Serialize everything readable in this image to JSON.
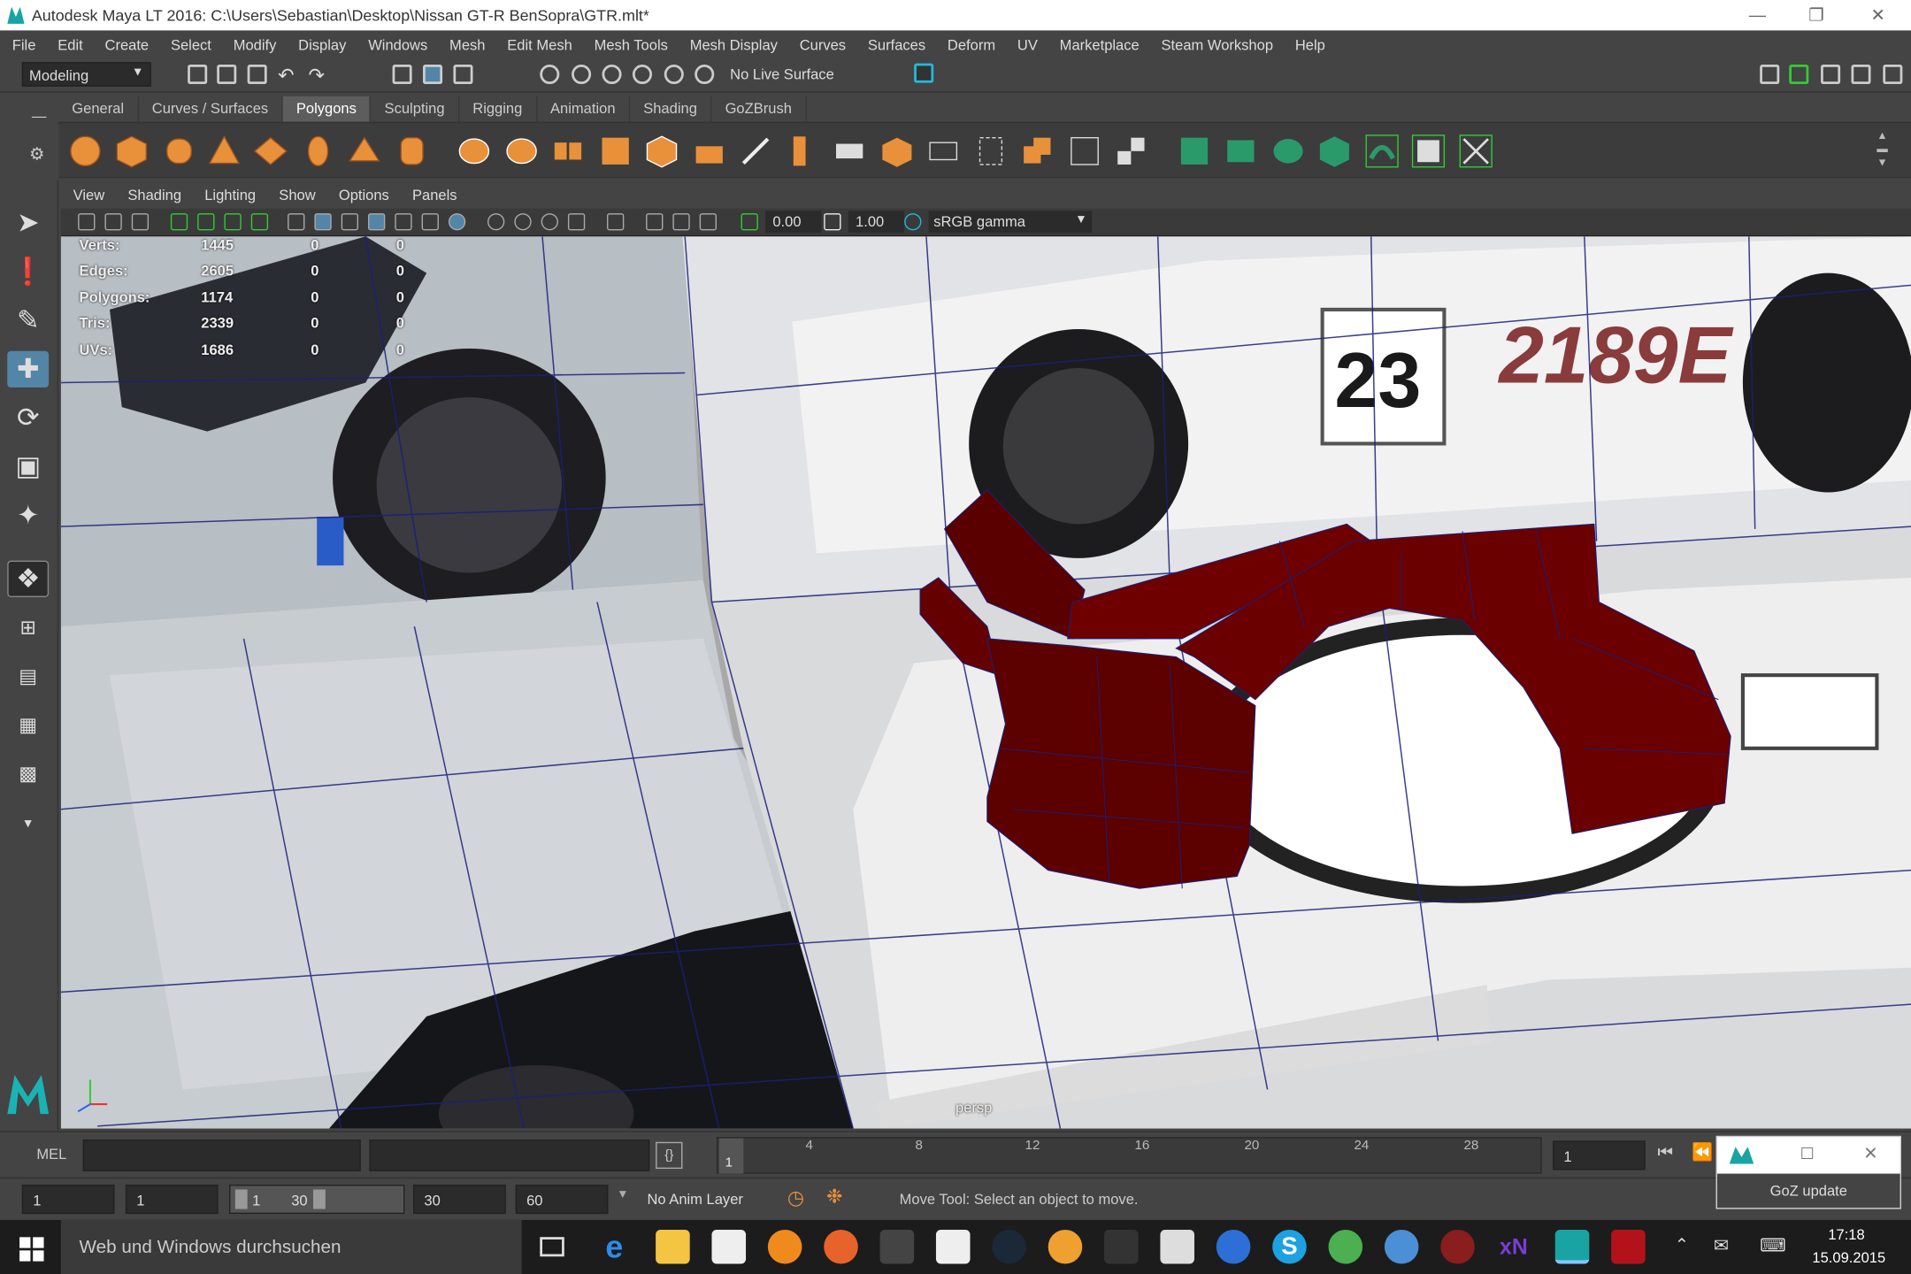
{
  "window": {
    "title": "Autodesk Maya LT 2016: C:\\Users\\Sebastian\\Desktop\\Nissan GT-R BenSopra\\GTR.mlt*"
  },
  "menu": [
    "File",
    "Edit",
    "Create",
    "Select",
    "Modify",
    "Display",
    "Windows",
    "Mesh",
    "Edit Mesh",
    "Mesh Tools",
    "Mesh Display",
    "Curves",
    "Surfaces",
    "Deform",
    "UV",
    "Marketplace",
    "Steam Workshop",
    "Help"
  ],
  "statusline": {
    "mode": "Modeling",
    "live_surface": "No Live Surface"
  },
  "shelf": {
    "tabs": [
      "General",
      "Curves / Surfaces",
      "Polygons",
      "Sculpting",
      "Rigging",
      "Animation",
      "Shading",
      "GoZBrush"
    ],
    "active": "Polygons"
  },
  "panel": {
    "menu": [
      "View",
      "Shading",
      "Lighting",
      "Show",
      "Options",
      "Panels"
    ],
    "exposure": "0.00",
    "gamma": "1.00",
    "colorspace": "sRGB gamma"
  },
  "hud": {
    "rows": [
      {
        "label": "Verts:",
        "a": "1445",
        "b": "0",
        "c": "0"
      },
      {
        "label": "Edges:",
        "a": "2605",
        "b": "0",
        "c": "0"
      },
      {
        "label": "Polygons:",
        "a": "1174",
        "b": "0",
        "c": "0"
      },
      {
        "label": "Tris:",
        "a": "2339",
        "b": "0",
        "c": "0"
      },
      {
        "label": "UVs:",
        "a": "1686",
        "b": "0",
        "c": "0"
      }
    ],
    "camera": "persp"
  },
  "timeline": {
    "ticks": [
      "1",
      "4",
      "8",
      "12",
      "16",
      "20",
      "24",
      "28"
    ],
    "current_frame": "1"
  },
  "command": {
    "label": "MEL"
  },
  "range": {
    "start": "1",
    "start2": "1",
    "slider_a": "1",
    "slider_b": "30",
    "end": "30",
    "end2": "60",
    "anim_layer": "No Anim Layer",
    "help": "Move Tool: Select an object to move."
  },
  "goz": {
    "label": "GoZ update"
  },
  "taskbar": {
    "search": "Web und Windows durchsuchen",
    "time": "17:18",
    "date": "15.09.2015"
  }
}
